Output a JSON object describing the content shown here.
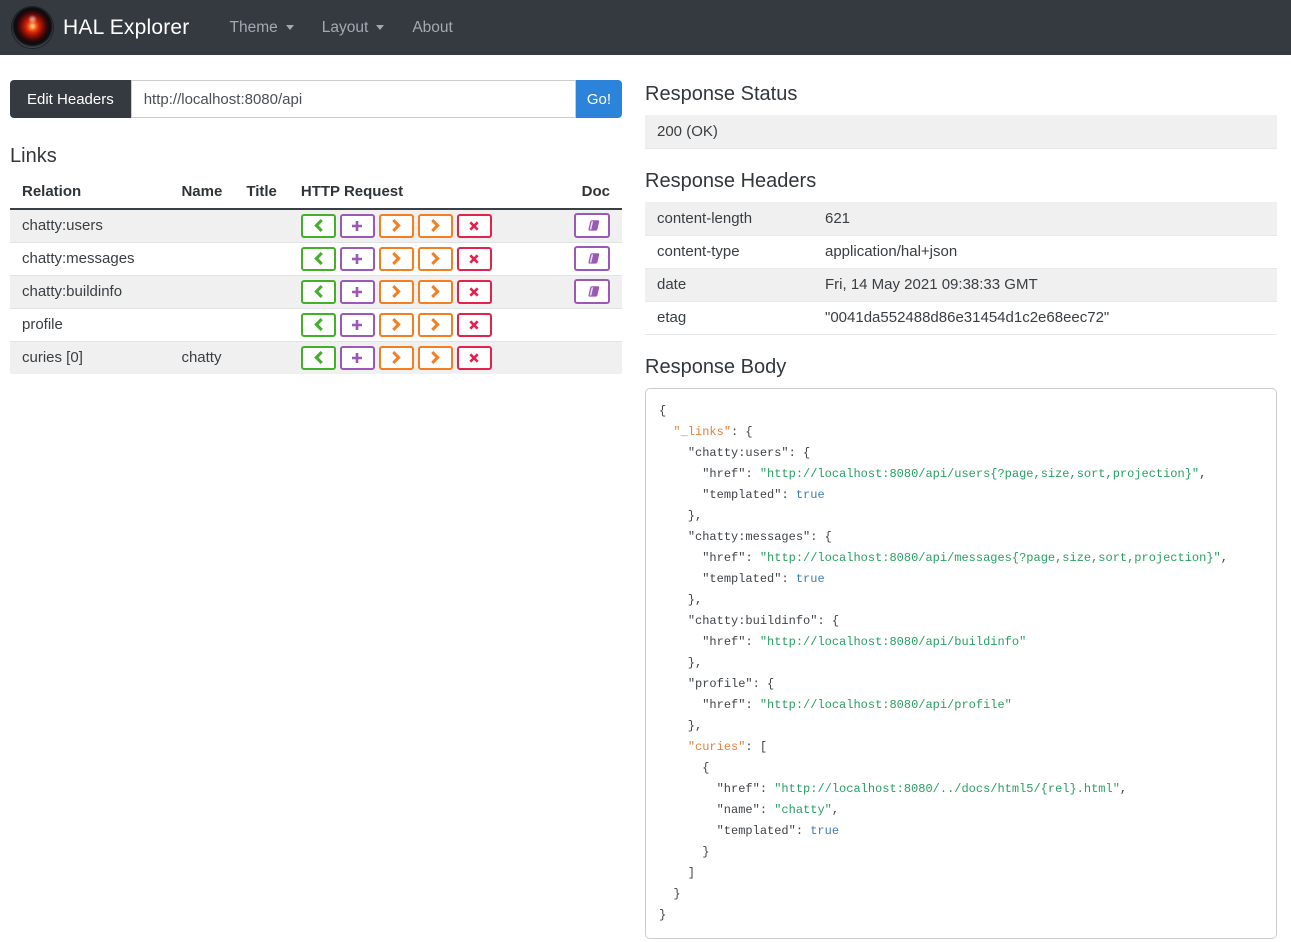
{
  "navbar": {
    "brand": "HAL Explorer",
    "items": [
      {
        "label": "Theme",
        "dropdown": true
      },
      {
        "label": "Layout",
        "dropdown": true
      },
      {
        "label": "About",
        "dropdown": false
      }
    ]
  },
  "url_bar": {
    "edit_headers_label": "Edit Headers",
    "url_value": "http://localhost:8080/api",
    "go_label": "Go!"
  },
  "links": {
    "heading": "Links",
    "columns": [
      "Relation",
      "Name",
      "Title",
      "HTTP Request",
      "Doc"
    ],
    "request_buttons": [
      "get",
      "post",
      "put",
      "patch",
      "delete"
    ],
    "rows": [
      {
        "relation": "chatty:users",
        "name": "",
        "title": "",
        "doc": true
      },
      {
        "relation": "chatty:messages",
        "name": "",
        "title": "",
        "doc": true
      },
      {
        "relation": "chatty:buildinfo",
        "name": "",
        "title": "",
        "doc": true
      },
      {
        "relation": "profile",
        "name": "",
        "title": "",
        "doc": false
      },
      {
        "relation": "curies [0]",
        "name": "chatty",
        "title": "",
        "doc": false
      }
    ]
  },
  "response_status": {
    "heading": "Response Status",
    "value": "200 (OK)"
  },
  "response_headers": {
    "heading": "Response Headers",
    "rows": [
      {
        "name": "content-length",
        "value": "621"
      },
      {
        "name": "content-type",
        "value": "application/hal+json"
      },
      {
        "name": "date",
        "value": "Fri, 14 May 2021 09:38:33 GMT"
      },
      {
        "name": "etag",
        "value": "\"0041da552488d86e31454d1c2e68eec72\""
      }
    ]
  },
  "response_body": {
    "heading": "Response Body",
    "special_keys": [
      "_links",
      "curies"
    ],
    "json": {
      "_links": {
        "chatty:users": {
          "href": "http://localhost:8080/api/users{?page,size,sort,projection}",
          "templated": true
        },
        "chatty:messages": {
          "href": "http://localhost:8080/api/messages{?page,size,sort,projection}",
          "templated": true
        },
        "chatty:buildinfo": {
          "href": "http://localhost:8080/api/buildinfo"
        },
        "profile": {
          "href": "http://localhost:8080/api/profile"
        },
        "curies": [
          {
            "href": "http://localhost:8080/../docs/html5/{rel}.html",
            "name": "chatty",
            "templated": true
          }
        ]
      }
    }
  },
  "colors": {
    "navbar_bg": "#343a40",
    "primary": "#2b83da",
    "row_stripe": "#f0f0f0",
    "get": "#43b02a",
    "post": "#9b59b6",
    "put": "#f57e20",
    "patch": "#f57e20",
    "delete": "#e3224e",
    "doc": "#9b59b6",
    "json_key": "#3f4449",
    "json_key_special": "#e8803a",
    "json_string": "#28a163",
    "json_boolean": "#3e7cb8"
  }
}
